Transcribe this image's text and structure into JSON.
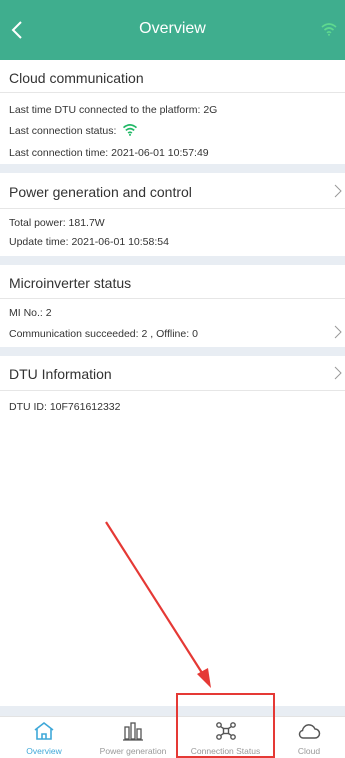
{
  "header": {
    "title": "Overview",
    "back_icon": "chevron-left-icon",
    "signal_icon": "wifi-icon",
    "bg_color": "#3fae8e"
  },
  "cloud": {
    "title": "Cloud communication",
    "last_connected": "Last time DTU connected to the platform: 2G",
    "last_status_label": "Last connection status:",
    "last_time": "Last connection time: 2021-06-01 10:57:49"
  },
  "power": {
    "title": "Power generation and control",
    "total": "Total power: 181.7W",
    "update": "Update time: 2021-06-01 10:58:54"
  },
  "micro": {
    "title": "Microinverter status",
    "mi_no": "MI No.: 2",
    "comm": "Communication succeeded: 2 , Offline: 0"
  },
  "dtu": {
    "title": "DTU Information",
    "id": "DTU ID: 10F761612332"
  },
  "tabs": [
    {
      "label": "Overview",
      "icon": "home-icon",
      "active": true
    },
    {
      "label": "Power generation",
      "icon": "bar-chart-icon",
      "active": false
    },
    {
      "label": "Connection Status",
      "icon": "network-icon",
      "active": false
    },
    {
      "label": "Cloud",
      "icon": "cloud-icon",
      "active": false
    }
  ],
  "colors": {
    "accent": "#3fae8e",
    "active_tab": "#3fa8d8",
    "annotation": "#e53935"
  }
}
